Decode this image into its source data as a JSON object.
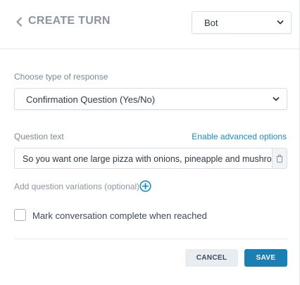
{
  "header": {
    "title": "CREATE TURN",
    "bot_select_value": "Bot"
  },
  "response_type": {
    "label": "Choose type of response",
    "value": "Confirmation Question (Yes/No)"
  },
  "question": {
    "label": "Question text",
    "advanced_link": "Enable advanced options",
    "value": "So you want one large pizza with onions, pineapple and mushro"
  },
  "variations": {
    "label": "Add question variations (optional)"
  },
  "complete_checkbox": {
    "label": "Mark conversation complete when reached",
    "checked": false
  },
  "actions": {
    "cancel_label": "CANCEL",
    "save_label": "SAVE"
  },
  "colors": {
    "accent": "#1b7fb3",
    "link": "#1a8dbf",
    "title": "#8b95a1"
  },
  "icons": {
    "back": "chevron-left-icon",
    "dropdown": "chevron-down-icon",
    "delete": "trash-icon",
    "add": "plus-circle-icon"
  }
}
